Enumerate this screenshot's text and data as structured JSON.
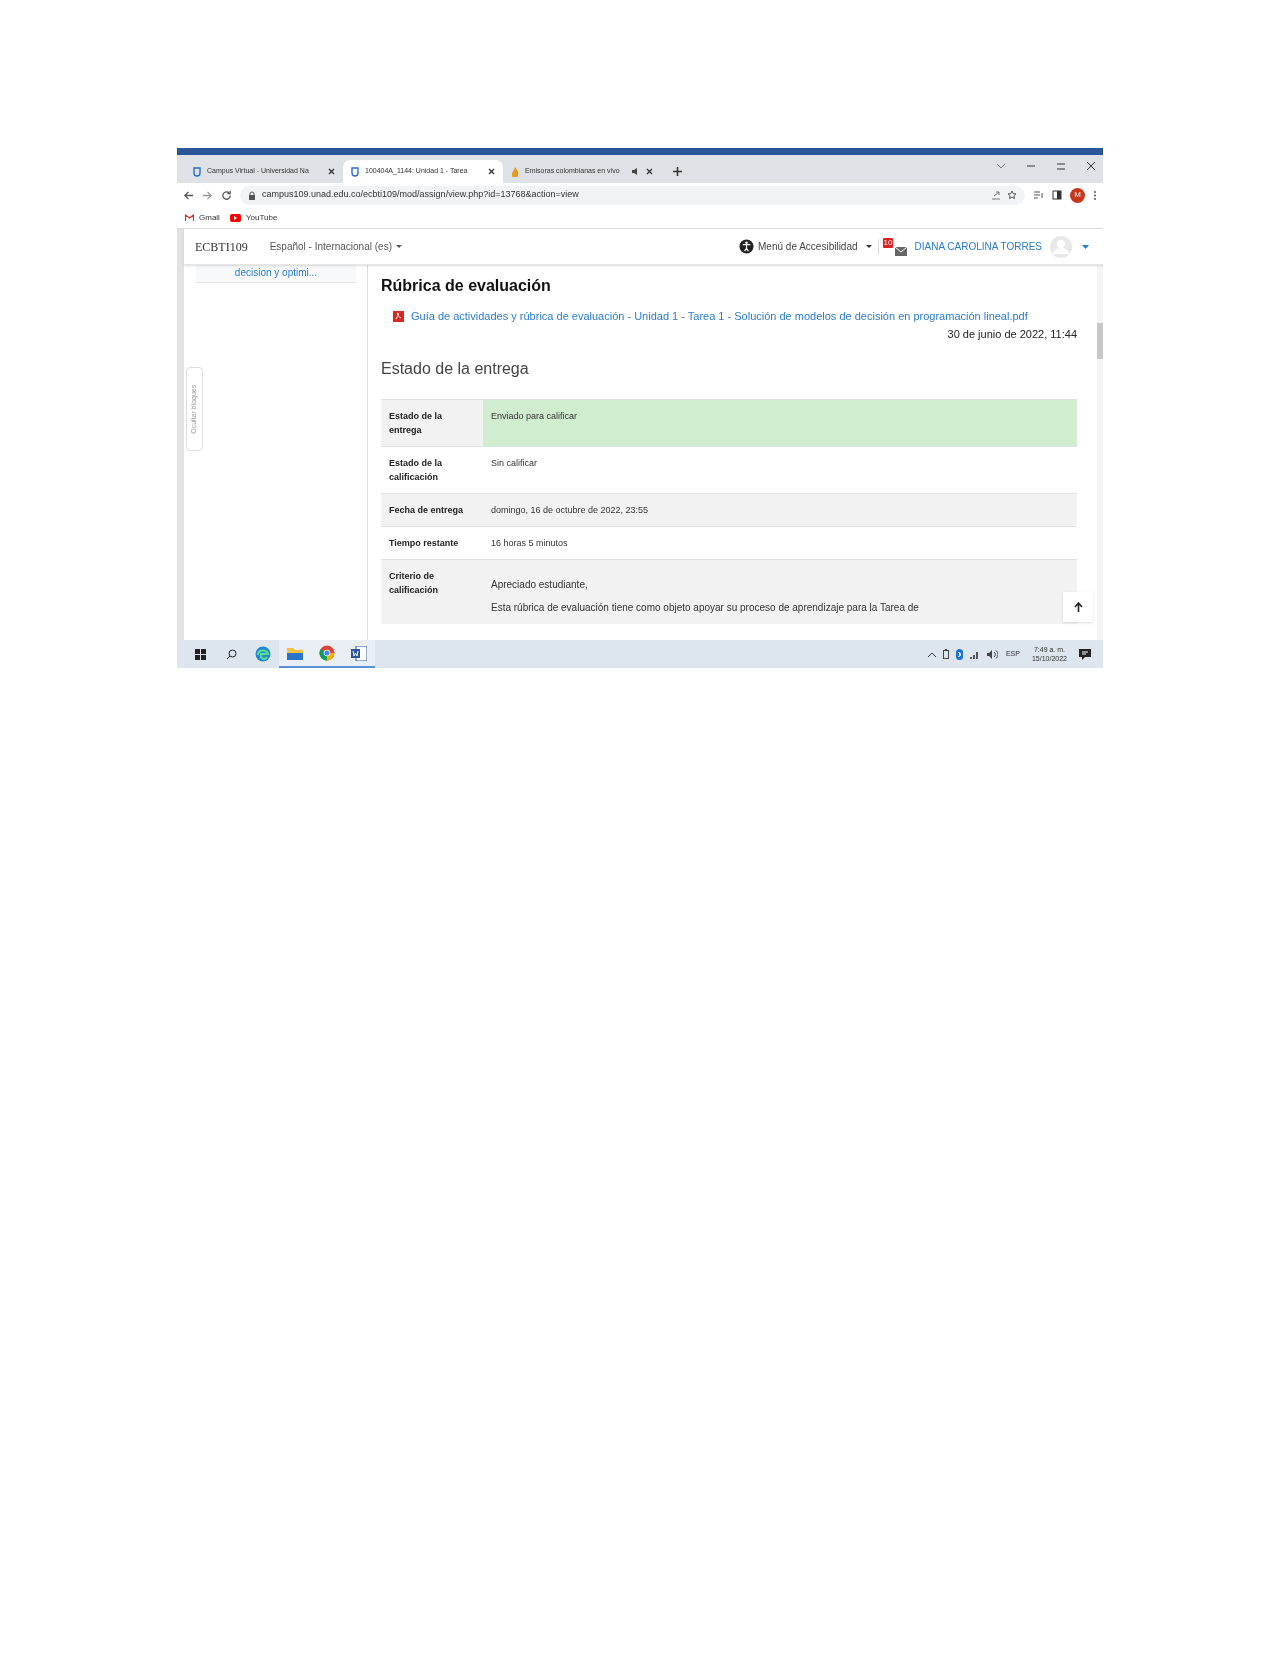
{
  "browser": {
    "tabs": [
      {
        "title": "Campus Virtual - Universidad Na",
        "selected": false
      },
      {
        "title": "100404A_1144: Unidad 1 - Tarea",
        "selected": true
      },
      {
        "title": "Emisoras colombianas en vivo",
        "selected": false,
        "muted": true
      }
    ],
    "url": "campus109.unad.edu.co/ecbti109/mod/assign/view.php?id=13768&action=view",
    "profile_initial": "M",
    "bookmarks": [
      {
        "label": "Gmail"
      },
      {
        "label": "YouTube"
      }
    ]
  },
  "navbar": {
    "site": "ECBTI109",
    "language": "Español - Internacional (es)",
    "accessibility": "Menú de Accesibilidad",
    "notification_count": "10",
    "user": "DIANA CAROLINA TORRES"
  },
  "sidebar": {
    "item": "decision y optimi...",
    "toggle": "Ocultar bloques"
  },
  "main": {
    "heading": "Rúbrica de evaluación",
    "file_link": "Guía de actividades y rúbrica de evaluación - Unidad 1 - Tarea 1 - Solución de modelos de decisión en programación lineal.pdf",
    "file_date": "30 de junio de 2022, 11:44",
    "section": "Estado de la entrega",
    "rows": [
      {
        "label": "Estado de la entrega",
        "value": [
          "Enviado para calificar"
        ],
        "highlight": true
      },
      {
        "label": "Estado de la calificación",
        "value": [
          "Sin calificar"
        ],
        "highlight": false
      },
      {
        "label": "Fecha de entrega",
        "value": [
          "domingo, 16 de octubre de 2022, 23:55"
        ],
        "highlight": false
      },
      {
        "label": "Tiempo restante",
        "value": [
          "16 horas 5 minutos"
        ],
        "highlight": false
      },
      {
        "label": "Criterio de calificación",
        "value": [
          "Apreciado estudiante,",
          "Esta rúbrica de evaluación tiene como objeto apoyar su proceso de aprendizaje para la Tarea de"
        ],
        "highlight": false
      }
    ]
  },
  "taskbar": {
    "apps": [
      {
        "kind": "edge",
        "active": false
      },
      {
        "kind": "folder",
        "active": true
      },
      {
        "kind": "chrome",
        "active": true
      },
      {
        "kind": "word",
        "active": true
      }
    ],
    "language": "ESP",
    "time": "7:49 a. m.",
    "date": "15/10/2022"
  }
}
